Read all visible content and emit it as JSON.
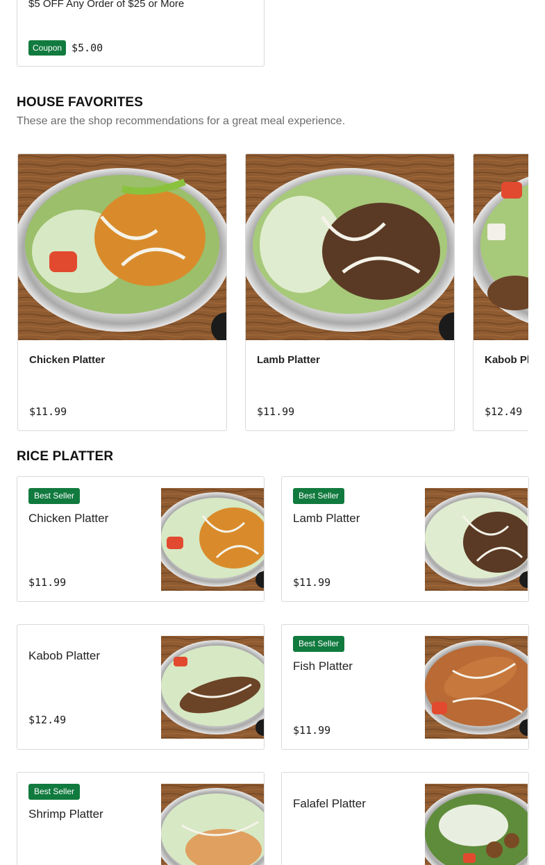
{
  "coupon": {
    "title": "$5 OFF Any Order of $25 or More",
    "badge": "Coupon",
    "value": "$5.00"
  },
  "house_favorites": {
    "title": "HOUSE FAVORITES",
    "subtitle": "These are the shop recommendations for a great meal experience.",
    "items": [
      {
        "name": "Chicken Platter",
        "price": "$11.99",
        "image": "chicken-platter-photo"
      },
      {
        "name": "Lamb Platter",
        "price": "$11.99",
        "image": "lamb-platter-photo"
      },
      {
        "name": "Kabob Platter",
        "price": "$12.49",
        "image": "kabob-platter-photo"
      }
    ]
  },
  "rice_platter": {
    "title": "RICE PLATTER",
    "items": [
      {
        "name": "Chicken Platter",
        "price": "$11.99",
        "badge": "Best Seller"
      },
      {
        "name": "Lamb Platter",
        "price": "$11.99",
        "badge": "Best Seller"
      },
      {
        "name": "Kabob Platter",
        "price": "$12.49",
        "badge": ""
      },
      {
        "name": "Fish Platter",
        "price": "$11.99",
        "badge": "Best Seller"
      },
      {
        "name": "Shrimp Platter",
        "price": "",
        "badge": "Best Seller"
      },
      {
        "name": "Falafel Platter",
        "price": "",
        "badge": ""
      }
    ]
  },
  "colors": {
    "badge_green": "#117a3e",
    "card_border": "#d9d9d9",
    "wood": "#8a5a32",
    "subtitle_gray": "#6b6b6b"
  }
}
